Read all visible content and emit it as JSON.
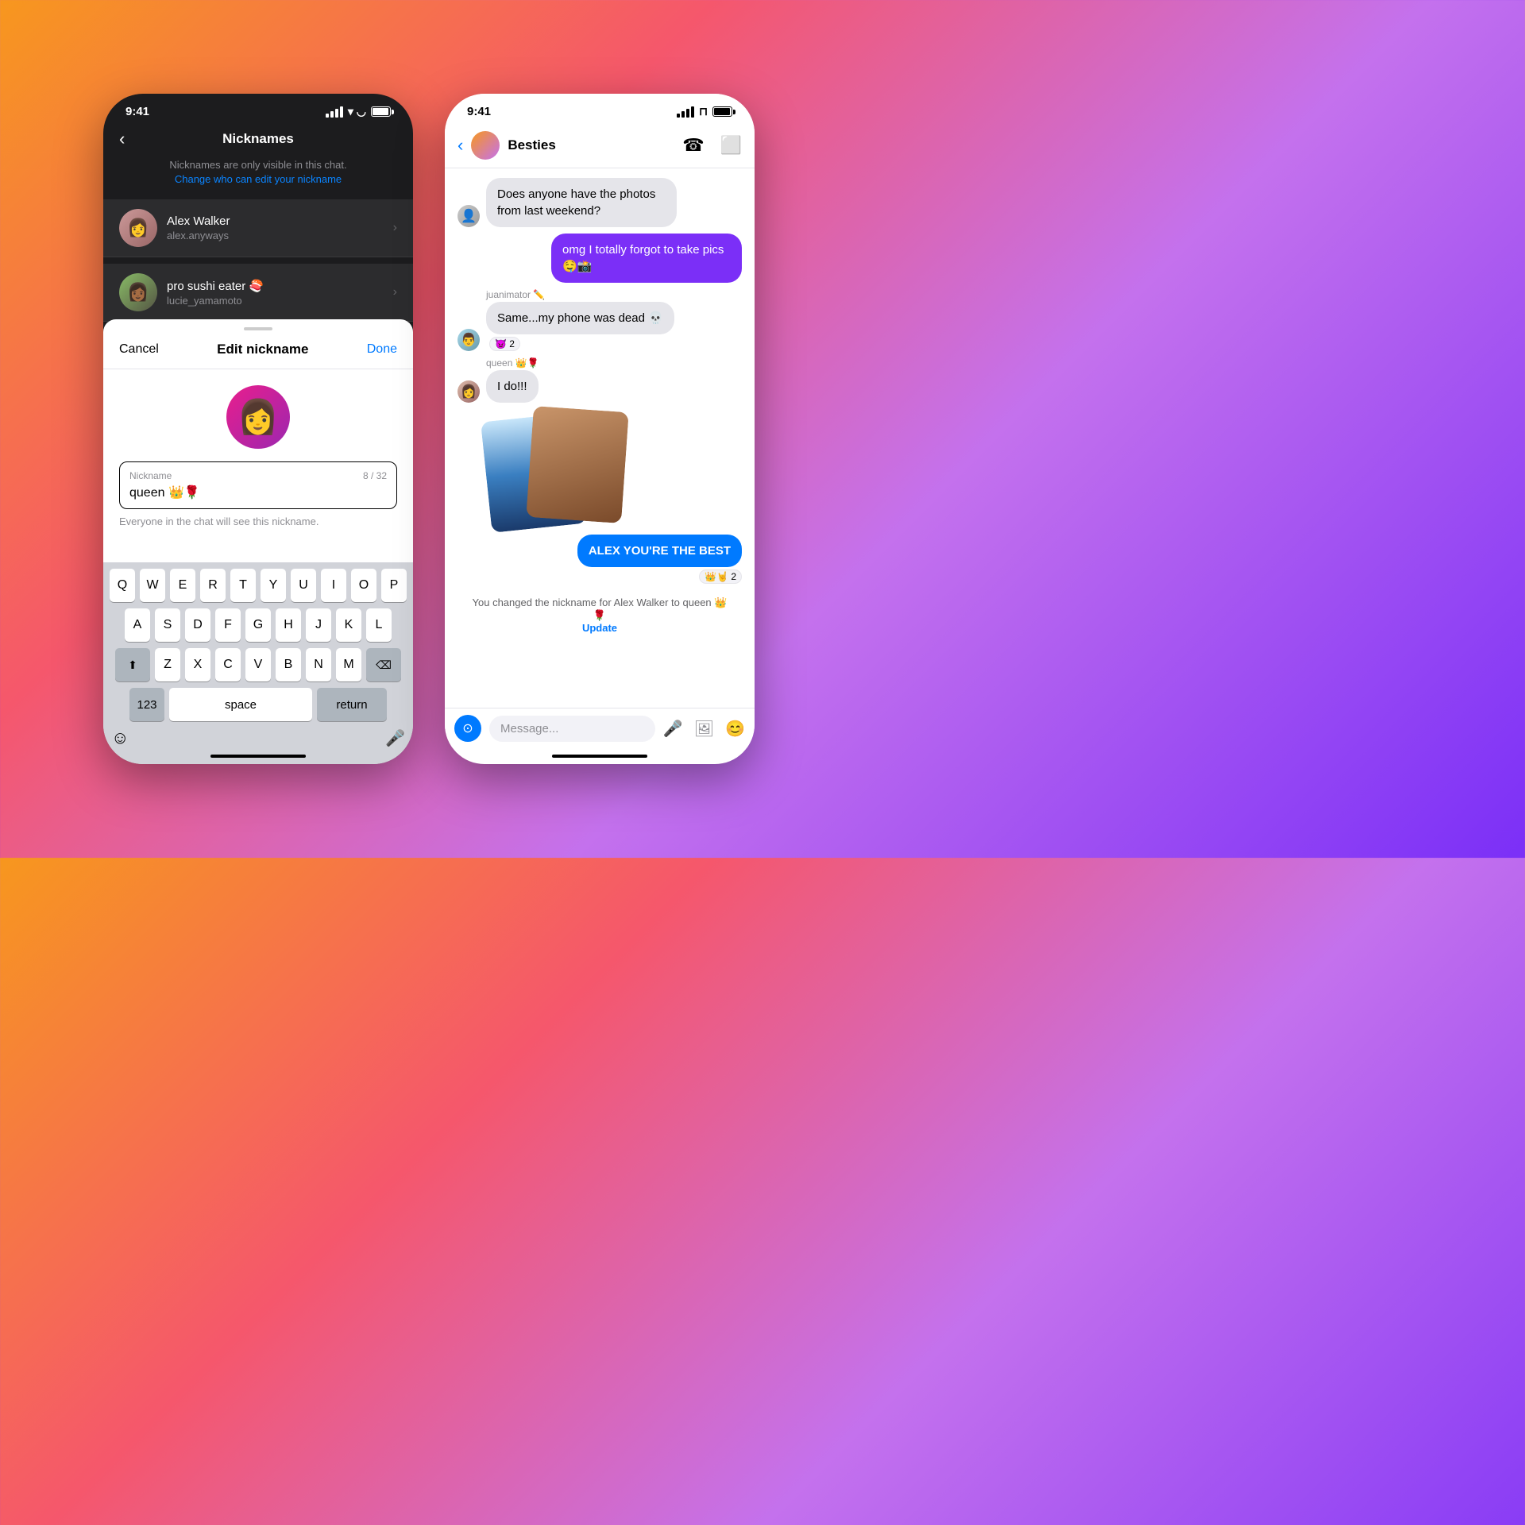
{
  "background": {
    "gradient": "linear-gradient(135deg, #f7971e 0%, #f5576c 30%, #c471ed 60%, #7b2ff7 100%)"
  },
  "phone_dark": {
    "status_bar": {
      "time": "9:41",
      "signal": "signal",
      "wifi": "wifi",
      "battery": "battery"
    },
    "header": {
      "back_label": "‹",
      "title": "Nicknames"
    },
    "subtitle": "Nicknames are only visible in this chat.",
    "subtitle_link": "Change who can edit your nickname",
    "contacts": [
      {
        "name": "Alex Walker",
        "username": "alex.anyways"
      },
      {
        "name": "pro sushi eater 🍣",
        "username": "lucie_yamamoto"
      }
    ],
    "bottom_sheet": {
      "cancel_label": "Cancel",
      "title": "Edit nickname",
      "done_label": "Done",
      "nickname_label": "Nickname",
      "nickname_value": "queen 👑🌹",
      "counter": "8 / 32",
      "hint": "Everyone in the chat will see this nickname."
    },
    "keyboard": {
      "rows": [
        [
          "Q",
          "W",
          "E",
          "R",
          "T",
          "Y",
          "U",
          "I",
          "O",
          "P"
        ],
        [
          "A",
          "S",
          "D",
          "F",
          "G",
          "H",
          "J",
          "K",
          "L"
        ],
        [
          "⬆",
          "Z",
          "X",
          "C",
          "V",
          "B",
          "N",
          "M",
          "⌫"
        ],
        [
          "123",
          "space",
          "return"
        ]
      ]
    }
  },
  "phone_light": {
    "status_bar": {
      "time": "9:41"
    },
    "header": {
      "back_label": "‹",
      "group_name": "Besties"
    },
    "messages": [
      {
        "id": 1,
        "sender": "other",
        "text": "Does anyone have the photos from last weekend?",
        "type": "gray"
      },
      {
        "id": 2,
        "sender": "me",
        "text": "omg I totally forgot to take pics 🤤📸",
        "type": "purple"
      },
      {
        "id": 3,
        "sender_name": "juanimator ✏️",
        "sender": "other2",
        "text": "Same...my phone was dead 💀",
        "reaction": "👿 2",
        "type": "gray"
      },
      {
        "id": 4,
        "sender_name": "queen 👑🌹",
        "sender": "other3",
        "text": "I do!!!",
        "type": "gray"
      },
      {
        "id": 5,
        "sender": "me",
        "text": "ALEX YOU'RE THE BEST",
        "type": "blue",
        "reaction": "👑🤘 2"
      }
    ],
    "system_message": "You changed the nickname for Alex Walker to queen 👑🌹",
    "update_label": "Update",
    "input_placeholder": "Message..."
  }
}
